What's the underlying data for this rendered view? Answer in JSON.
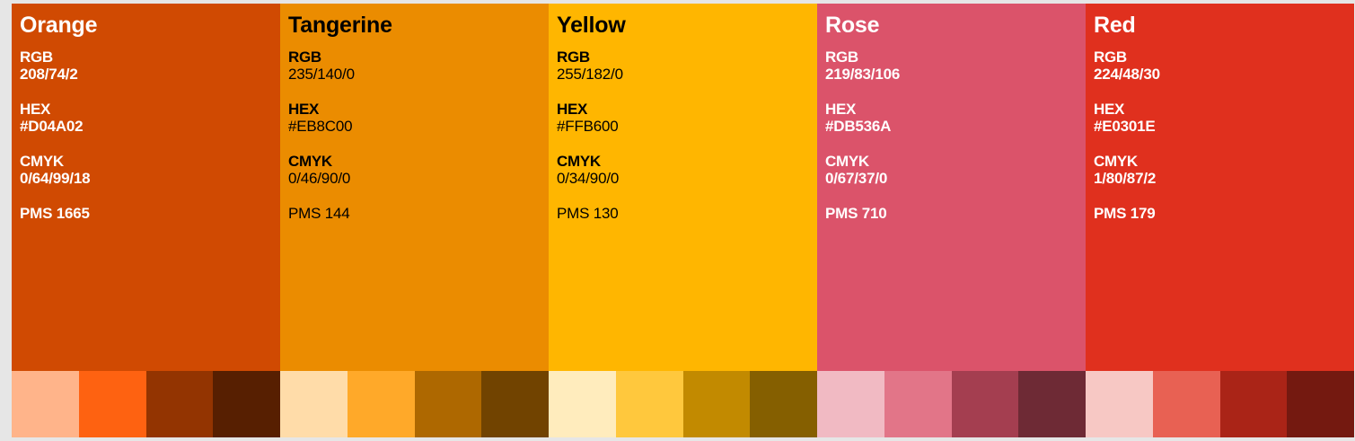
{
  "palette": [
    {
      "name": "Orange",
      "rgb_label": "RGB",
      "rgb": "208/74/2",
      "hex_label": "HEX",
      "hex": "#D04A02",
      "cmyk_label": "CMYK",
      "cmyk": "0/64/99/18",
      "pms": "PMS 1665",
      "color": "#D04A02",
      "text_color": "light",
      "tints": [
        "#FFB48A",
        "#FE6211",
        "#933401",
        "#571F01"
      ]
    },
    {
      "name": "Tangerine",
      "rgb_label": "RGB",
      "rgb": "235/140/0",
      "hex_label": "HEX",
      "hex": "#EB8C00",
      "cmyk_label": "CMYK",
      "cmyk": "0/46/90/0",
      "pms": "PMS 144",
      "color": "#EB8C00",
      "text_color": "dark",
      "tints": [
        "#FFDCA9",
        "#FFA929",
        "#AE6800",
        "#714300"
      ]
    },
    {
      "name": "Yellow",
      "rgb_label": "RGB",
      "rgb": "255/182/0",
      "hex_label": "HEX",
      "hex": "#FFB600",
      "cmyk_label": "CMYK",
      "cmyk": "0/34/90/0",
      "pms": "PMS 130",
      "color": "#FFB600",
      "text_color": "dark",
      "tints": [
        "#FFECBD",
        "#FFC83D",
        "#C28A00",
        "#855F00"
      ]
    },
    {
      "name": "Rose",
      "rgb_label": "RGB",
      "rgb": "219/83/106",
      "hex_label": "HEX",
      "hex": "#DB536A",
      "cmyk_label": "CMYK",
      "cmyk": "0/67/37/0",
      "pms": "PMS 710",
      "color": "#DB536A",
      "text_color": "light",
      "tints": [
        "#F1BAC3",
        "#E27588",
        "#A43E50",
        "#6E2A35"
      ]
    },
    {
      "name": "Red",
      "rgb_label": "RGB",
      "rgb": "224/48/30",
      "hex_label": "HEX",
      "hex": "#E0301E",
      "cmyk_label": "CMYK",
      "cmyk": "1/80/87/2",
      "pms": "PMS 179",
      "color": "#E0301E",
      "text_color": "light",
      "tints": [
        "#F7C8C4",
        "#E86153",
        "#AA2417",
        "#741910"
      ]
    }
  ]
}
